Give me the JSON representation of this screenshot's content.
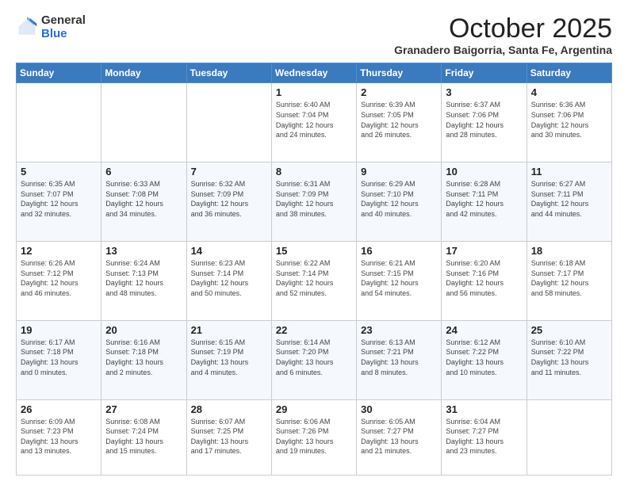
{
  "logo": {
    "general": "General",
    "blue": "Blue"
  },
  "title": "October 2025",
  "subtitle": "Granadero Baigorria, Santa Fe, Argentina",
  "headers": [
    "Sunday",
    "Monday",
    "Tuesday",
    "Wednesday",
    "Thursday",
    "Friday",
    "Saturday"
  ],
  "weeks": [
    [
      {
        "day": "",
        "info": ""
      },
      {
        "day": "",
        "info": ""
      },
      {
        "day": "",
        "info": ""
      },
      {
        "day": "1",
        "info": "Sunrise: 6:40 AM\nSunset: 7:04 PM\nDaylight: 12 hours\nand 24 minutes."
      },
      {
        "day": "2",
        "info": "Sunrise: 6:39 AM\nSunset: 7:05 PM\nDaylight: 12 hours\nand 26 minutes."
      },
      {
        "day": "3",
        "info": "Sunrise: 6:37 AM\nSunset: 7:06 PM\nDaylight: 12 hours\nand 28 minutes."
      },
      {
        "day": "4",
        "info": "Sunrise: 6:36 AM\nSunset: 7:06 PM\nDaylight: 12 hours\nand 30 minutes."
      }
    ],
    [
      {
        "day": "5",
        "info": "Sunrise: 6:35 AM\nSunset: 7:07 PM\nDaylight: 12 hours\nand 32 minutes."
      },
      {
        "day": "6",
        "info": "Sunrise: 6:33 AM\nSunset: 7:08 PM\nDaylight: 12 hours\nand 34 minutes."
      },
      {
        "day": "7",
        "info": "Sunrise: 6:32 AM\nSunset: 7:09 PM\nDaylight: 12 hours\nand 36 minutes."
      },
      {
        "day": "8",
        "info": "Sunrise: 6:31 AM\nSunset: 7:09 PM\nDaylight: 12 hours\nand 38 minutes."
      },
      {
        "day": "9",
        "info": "Sunrise: 6:29 AM\nSunset: 7:10 PM\nDaylight: 12 hours\nand 40 minutes."
      },
      {
        "day": "10",
        "info": "Sunrise: 6:28 AM\nSunset: 7:11 PM\nDaylight: 12 hours\nand 42 minutes."
      },
      {
        "day": "11",
        "info": "Sunrise: 6:27 AM\nSunset: 7:11 PM\nDaylight: 12 hours\nand 44 minutes."
      }
    ],
    [
      {
        "day": "12",
        "info": "Sunrise: 6:26 AM\nSunset: 7:12 PM\nDaylight: 12 hours\nand 46 minutes."
      },
      {
        "day": "13",
        "info": "Sunrise: 6:24 AM\nSunset: 7:13 PM\nDaylight: 12 hours\nand 48 minutes."
      },
      {
        "day": "14",
        "info": "Sunrise: 6:23 AM\nSunset: 7:14 PM\nDaylight: 12 hours\nand 50 minutes."
      },
      {
        "day": "15",
        "info": "Sunrise: 6:22 AM\nSunset: 7:14 PM\nDaylight: 12 hours\nand 52 minutes."
      },
      {
        "day": "16",
        "info": "Sunrise: 6:21 AM\nSunset: 7:15 PM\nDaylight: 12 hours\nand 54 minutes."
      },
      {
        "day": "17",
        "info": "Sunrise: 6:20 AM\nSunset: 7:16 PM\nDaylight: 12 hours\nand 56 minutes."
      },
      {
        "day": "18",
        "info": "Sunrise: 6:18 AM\nSunset: 7:17 PM\nDaylight: 12 hours\nand 58 minutes."
      }
    ],
    [
      {
        "day": "19",
        "info": "Sunrise: 6:17 AM\nSunset: 7:18 PM\nDaylight: 13 hours\nand 0 minutes."
      },
      {
        "day": "20",
        "info": "Sunrise: 6:16 AM\nSunset: 7:18 PM\nDaylight: 13 hours\nand 2 minutes."
      },
      {
        "day": "21",
        "info": "Sunrise: 6:15 AM\nSunset: 7:19 PM\nDaylight: 13 hours\nand 4 minutes."
      },
      {
        "day": "22",
        "info": "Sunrise: 6:14 AM\nSunset: 7:20 PM\nDaylight: 13 hours\nand 6 minutes."
      },
      {
        "day": "23",
        "info": "Sunrise: 6:13 AM\nSunset: 7:21 PM\nDaylight: 13 hours\nand 8 minutes."
      },
      {
        "day": "24",
        "info": "Sunrise: 6:12 AM\nSunset: 7:22 PM\nDaylight: 13 hours\nand 10 minutes."
      },
      {
        "day": "25",
        "info": "Sunrise: 6:10 AM\nSunset: 7:22 PM\nDaylight: 13 hours\nand 11 minutes."
      }
    ],
    [
      {
        "day": "26",
        "info": "Sunrise: 6:09 AM\nSunset: 7:23 PM\nDaylight: 13 hours\nand 13 minutes."
      },
      {
        "day": "27",
        "info": "Sunrise: 6:08 AM\nSunset: 7:24 PM\nDaylight: 13 hours\nand 15 minutes."
      },
      {
        "day": "28",
        "info": "Sunrise: 6:07 AM\nSunset: 7:25 PM\nDaylight: 13 hours\nand 17 minutes."
      },
      {
        "day": "29",
        "info": "Sunrise: 6:06 AM\nSunset: 7:26 PM\nDaylight: 13 hours\nand 19 minutes."
      },
      {
        "day": "30",
        "info": "Sunrise: 6:05 AM\nSunset: 7:27 PM\nDaylight: 13 hours\nand 21 minutes."
      },
      {
        "day": "31",
        "info": "Sunrise: 6:04 AM\nSunset: 7:27 PM\nDaylight: 13 hours\nand 23 minutes."
      },
      {
        "day": "",
        "info": ""
      }
    ]
  ]
}
